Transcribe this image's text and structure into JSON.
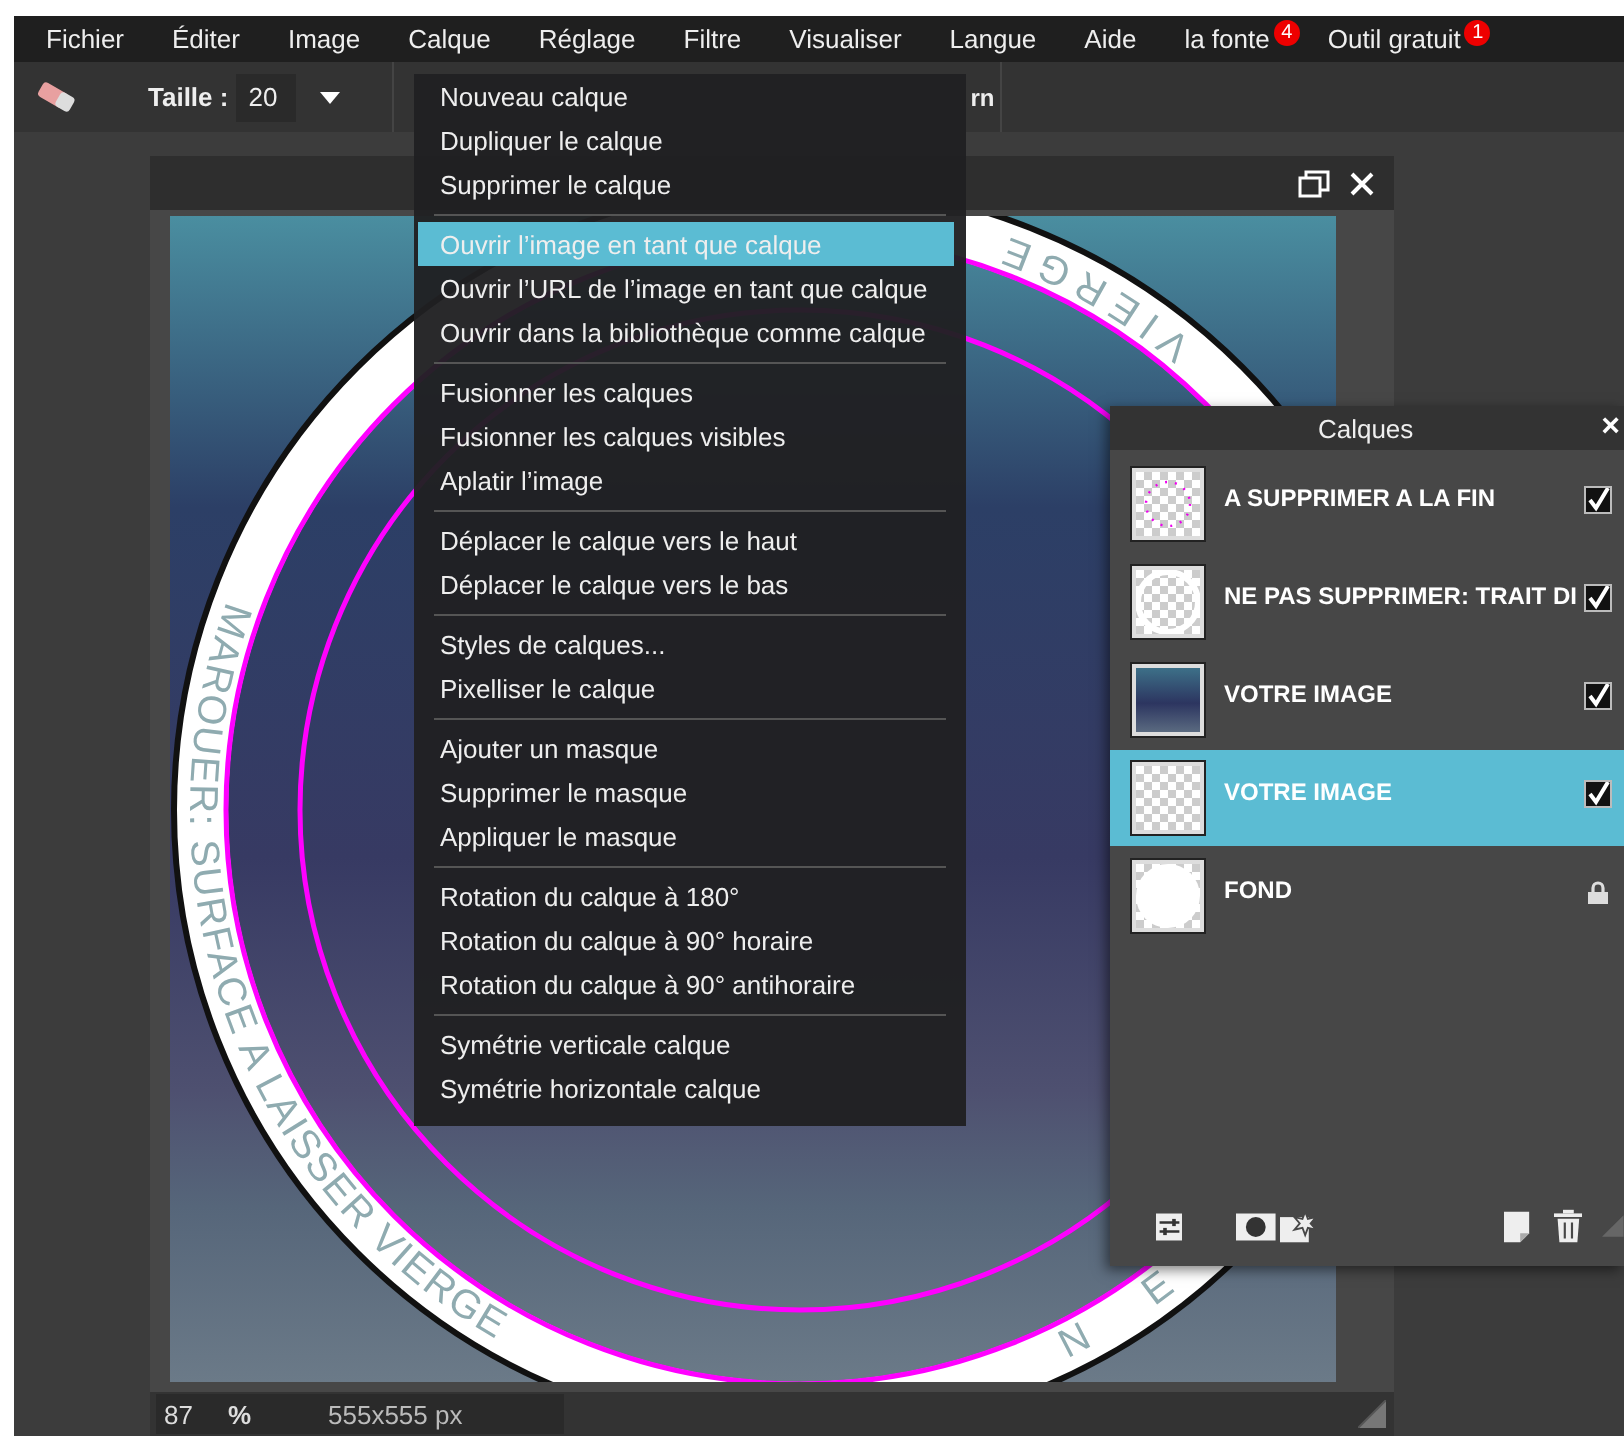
{
  "menubar": {
    "items": [
      {
        "label": "Fichier"
      },
      {
        "label": "Éditer"
      },
      {
        "label": "Image"
      },
      {
        "label": "Calque"
      },
      {
        "label": "Réglage"
      },
      {
        "label": "Filtre"
      },
      {
        "label": "Visualiser"
      },
      {
        "label": "Langue"
      },
      {
        "label": "Aide"
      },
      {
        "label": "la fonte",
        "badge": "4"
      },
      {
        "label": "Outil gratuit",
        "badge": "1"
      }
    ]
  },
  "toolbar": {
    "size_label": "Taille :",
    "size_value": "20",
    "buttons": [
      "rn"
    ]
  },
  "document": {
    "ring_texts": [
      "MAROUER: SURFACE A LAISSER VIERGE",
      "VIERGE",
      "NE"
    ],
    "zoom": "87",
    "zoom_unit": "%",
    "dimensions": "555x555 px"
  },
  "layer_menu": {
    "groups": [
      {
        "items": [
          {
            "label": "Nouveau calque",
            "selected": false
          },
          {
            "label": "Dupliquer le calque",
            "selected": false
          },
          {
            "label": "Supprimer le calque",
            "selected": false
          }
        ]
      },
      {
        "items": [
          {
            "label": "Ouvrir l’image en tant que calque",
            "selected": true
          },
          {
            "label": "Ouvrir l’URL de l’image en tant que calque",
            "selected": false
          },
          {
            "label": "Ouvrir dans la bibliothèque comme calque",
            "selected": false
          }
        ]
      },
      {
        "items": [
          {
            "label": "Fusionner les calques",
            "selected": false
          },
          {
            "label": "Fusionner les calques visibles",
            "selected": false
          },
          {
            "label": "Aplatir l’image",
            "selected": false
          }
        ]
      },
      {
        "items": [
          {
            "label": "Déplacer le calque vers le haut",
            "selected": false
          },
          {
            "label": "Déplacer le calque vers le bas",
            "selected": false
          }
        ]
      },
      {
        "items": [
          {
            "label": "Styles de calques...",
            "selected": false
          },
          {
            "label": "Pixelliser le calque",
            "selected": false
          }
        ]
      },
      {
        "items": [
          {
            "label": "Ajouter un masque",
            "selected": false
          },
          {
            "label": "Supprimer le masque",
            "selected": false
          },
          {
            "label": "Appliquer le masque",
            "selected": false
          }
        ]
      },
      {
        "items": [
          {
            "label": "Rotation du calque à 180°",
            "selected": false
          },
          {
            "label": "Rotation du calque à 90° horaire",
            "selected": false
          },
          {
            "label": "Rotation du calque à 90° antihoraire",
            "selected": false
          }
        ]
      },
      {
        "items": [
          {
            "label": "Symétrie verticale calque",
            "selected": false
          },
          {
            "label": "Symétrie horizontale calque",
            "selected": false
          }
        ]
      }
    ]
  },
  "layers_panel": {
    "title": "Calques",
    "close": "×",
    "layers": [
      {
        "name": "A SUPPRIMER A LA FIN",
        "kind": "dots",
        "visible": true,
        "locked": false,
        "selected": false
      },
      {
        "name": "NE PAS SUPPRIMER: TRAIT DI",
        "kind": "outline",
        "visible": true,
        "locked": false,
        "selected": false
      },
      {
        "name": "VOTRE IMAGE",
        "kind": "photo",
        "visible": true,
        "locked": false,
        "selected": false
      },
      {
        "name": "VOTRE IMAGE",
        "kind": "transparent",
        "visible": true,
        "locked": false,
        "selected": true
      },
      {
        "name": "FOND",
        "kind": "white-circle",
        "locked": true,
        "selected": false
      }
    ]
  }
}
